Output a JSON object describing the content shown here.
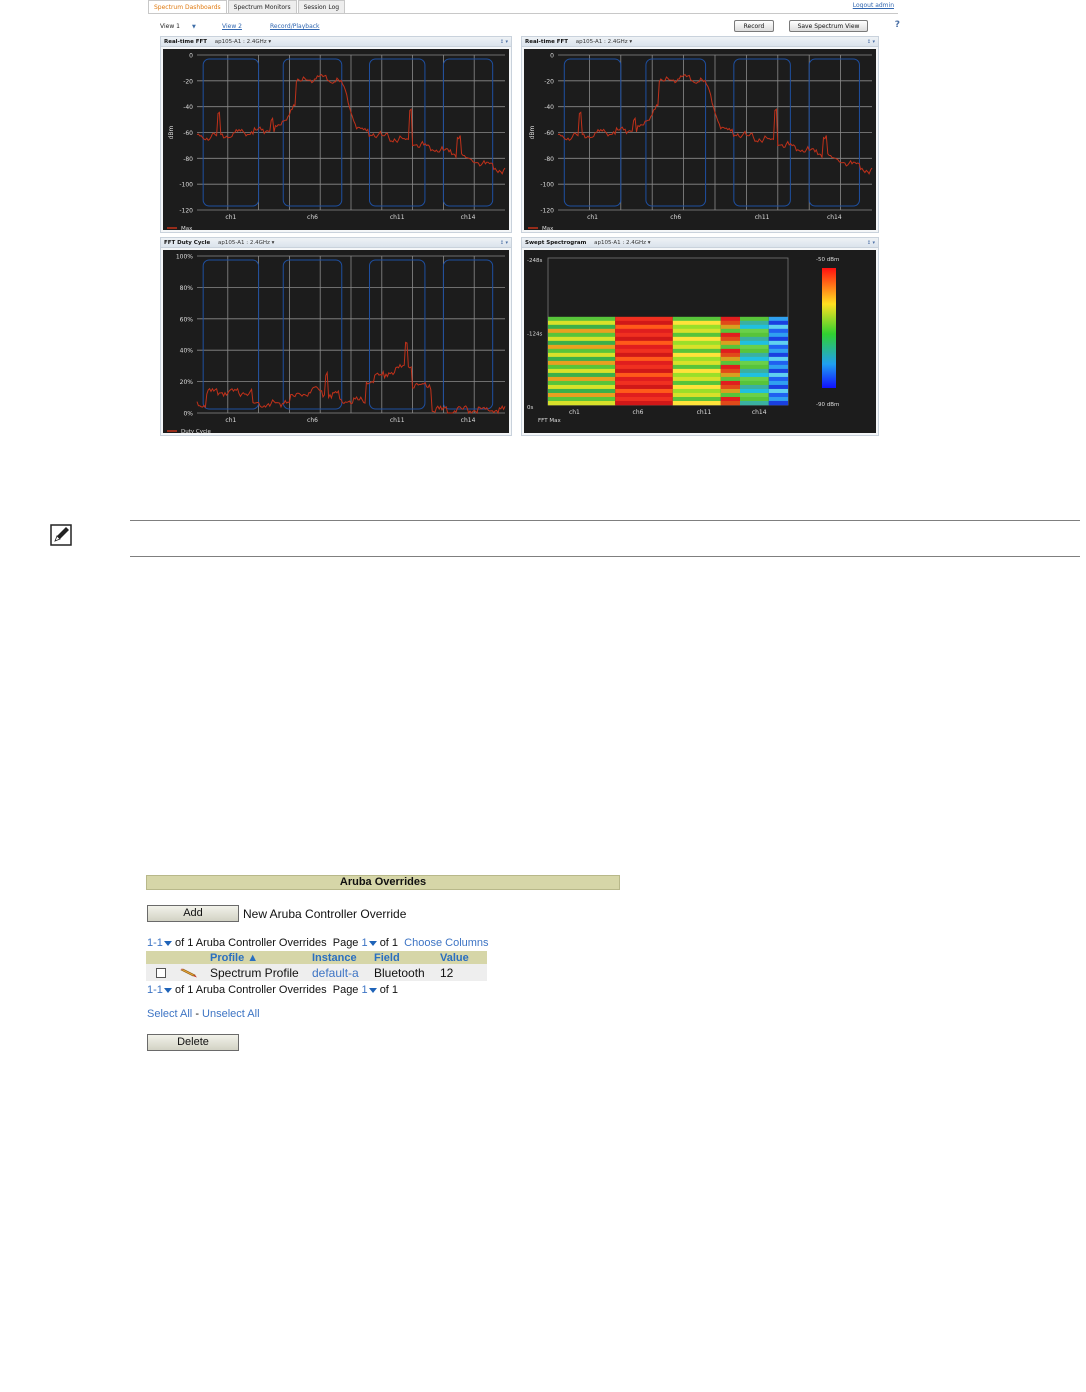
{
  "spectrum": {
    "tabs": [
      "Spectrum Dashboards",
      "Spectrum Monitors",
      "Session Log"
    ],
    "logout": "Logout admin",
    "view_select": "View 1",
    "view2": "View 2",
    "record_playback": "Record/Playback",
    "record_button": "Record",
    "save_button": "Save Spectrum View",
    "help": "?",
    "panel_controls": "↕ ▾",
    "panels": {
      "fft1": {
        "title": "Real-time FFT",
        "source": "ap105-A1 : 2.4GHz ▾",
        "legend": "Max",
        "ylabel": "dBm"
      },
      "fft2": {
        "title": "Real-time FFT",
        "source": "ap105-A1 : 2.4GHz ▾",
        "legend": "Max",
        "ylabel": "dBm"
      },
      "duty": {
        "title": "FFT Duty Cycle",
        "source": "ap105-A1 : 2.4GHz ▾",
        "legend": "Duty Cycle"
      },
      "spectrogram": {
        "title": "Swept Spectrogram",
        "source": "ap105-A1 : 2.4GHz ▾",
        "legend": "FFT Max",
        "y_ticks": [
          "-248s",
          "-124s",
          "0s"
        ],
        "scale_top": "-50 dBm",
        "scale_bottom": "-90 dBm"
      }
    },
    "x_ticks": [
      "ch1",
      "ch6",
      "ch11",
      "ch14"
    ],
    "fft_y_ticks": [
      "0",
      "-20",
      "-40",
      "-60",
      "-80",
      "-100",
      "-120"
    ],
    "duty_y_ticks": [
      "100%",
      "80%",
      "60%",
      "40%",
      "20%",
      "0%"
    ],
    "colors": {
      "trace": "#c0311a",
      "channel": "#1e4fa0",
      "grid": "#8a8a8a",
      "plot_bg": "#1c1c1c"
    }
  },
  "chart_data": [
    {
      "type": "line",
      "title": "Real-time FFT",
      "ylabel": "dBm",
      "ylim": [
        -120,
        0
      ],
      "x": [
        "ch1",
        "ch6",
        "ch11",
        "ch14"
      ],
      "series": [
        {
          "name": "Max",
          "values": [
            -64,
            -60,
            -20,
            -18,
            -55,
            -70,
            -80,
            -92
          ]
        }
      ]
    },
    {
      "type": "line",
      "title": "Real-time FFT",
      "ylabel": "dBm",
      "ylim": [
        -120,
        0
      ],
      "x": [
        "ch1",
        "ch6",
        "ch11",
        "ch14"
      ],
      "series": [
        {
          "name": "Max",
          "values": [
            -64,
            -60,
            -20,
            -18,
            -55,
            -70,
            -80,
            -92
          ]
        }
      ]
    },
    {
      "type": "line",
      "title": "FFT Duty Cycle",
      "ylim": [
        0,
        100
      ],
      "x": [
        "ch1",
        "ch6",
        "ch11",
        "ch14"
      ],
      "series": [
        {
          "name": "Duty Cycle",
          "values": [
            15,
            12,
            5,
            20,
            10,
            25,
            30,
            3
          ]
        }
      ]
    },
    {
      "type": "heatmap",
      "title": "Swept Spectrogram",
      "x": [
        "ch1",
        "ch6",
        "ch11",
        "ch14"
      ],
      "y": [
        "-248s",
        "-124s",
        "0s"
      ],
      "scale": [
        "-50 dBm",
        "-90 dBm"
      ],
      "legend": "FFT Max"
    }
  ],
  "note_icon": "pencil-note-icon",
  "overrides": {
    "title": "Aruba Overrides",
    "add_button": "Add",
    "add_label": "New Aruba Controller Override",
    "pager_range": "1-1",
    "pager_text": "of 1 Aruba Controller Overrides",
    "page_label": "Page",
    "page_num": "1",
    "page_of": "of 1",
    "choose_columns": "Choose Columns",
    "columns": {
      "profile": "Profile ▲",
      "instance": "Instance",
      "field": "Field",
      "value": "Value"
    },
    "rows": [
      {
        "profile": "Spectrum Profile",
        "instance": "default-a",
        "field": "Bluetooth",
        "value": "12"
      }
    ],
    "select_all": "Select All",
    "separator": "-",
    "unselect_all": "Unselect All",
    "delete_button": "Delete"
  }
}
